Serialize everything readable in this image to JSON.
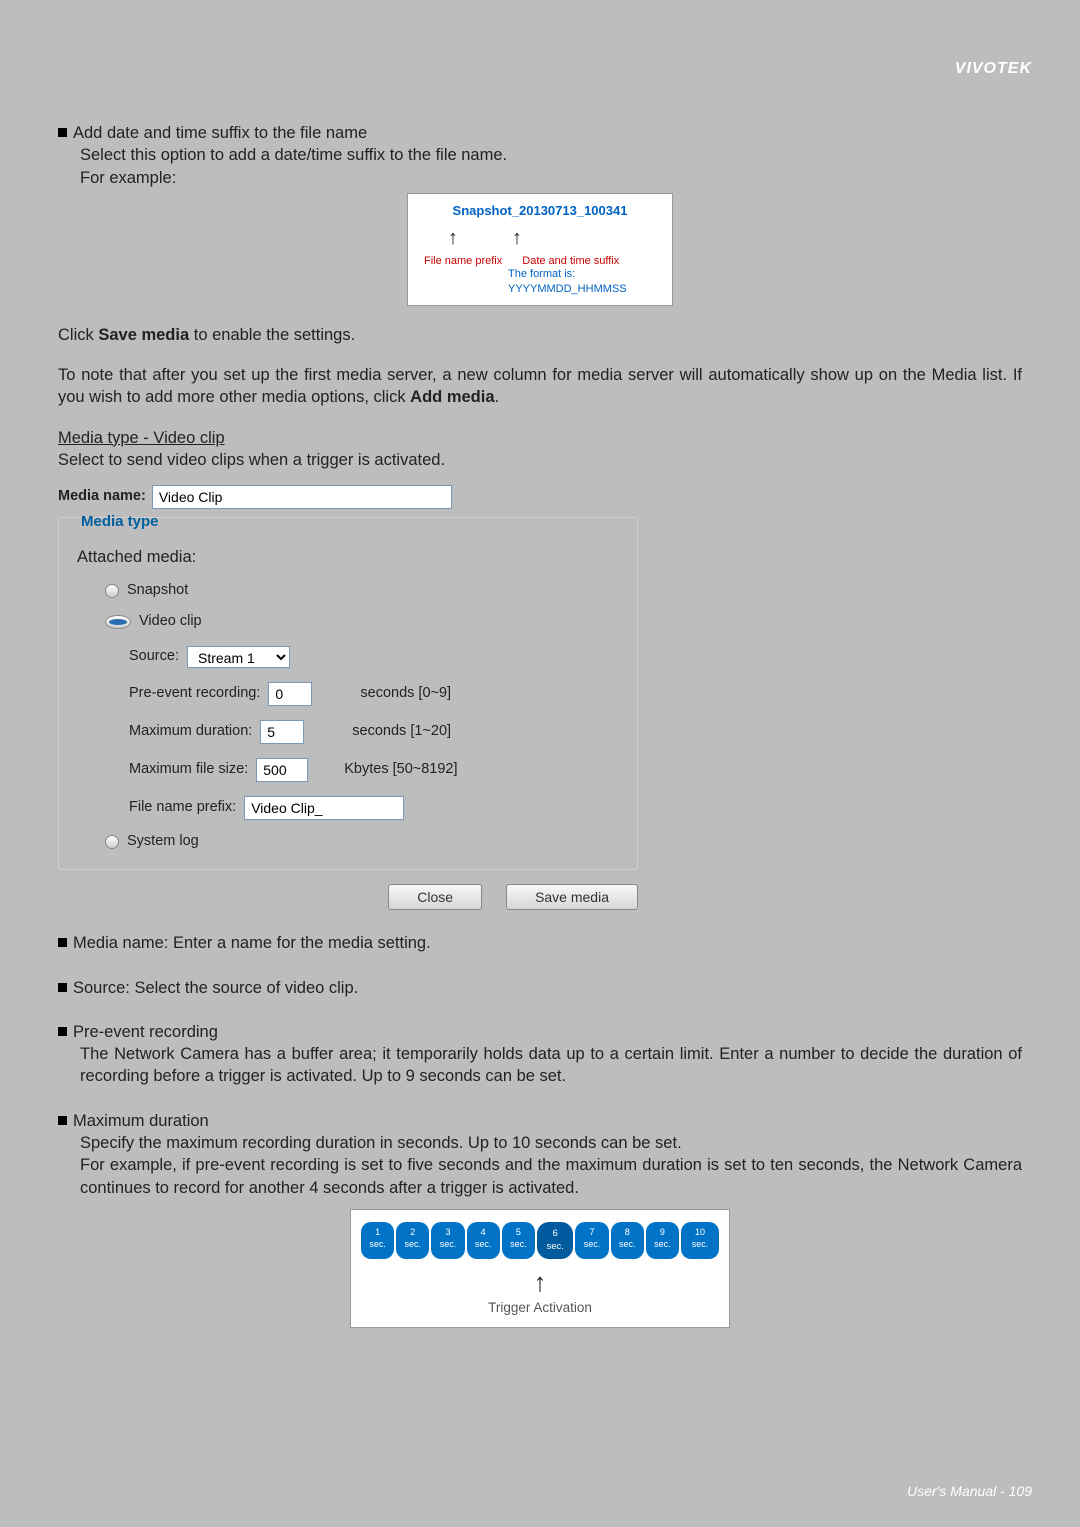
{
  "brand": "VIVOTEK",
  "bullet_add_suffix_title": "Add date and time suffix to the file name",
  "bullet_add_suffix_line1": "Select this option to add a date/time suffix to the file name.",
  "bullet_add_suffix_line2": "For example:",
  "snapshot": {
    "title": "Snapshot_20130713_100341",
    "fnp": "File name prefix",
    "dts": "Date and time suffix",
    "fmt": "The format is: YYYYMMDD_HHMMSS"
  },
  "click_save_pre": "Click ",
  "click_save_bold": "Save media",
  "click_save_post": " to enable the settings.",
  "note_para_pre": "To note that after you set up the first media server, a new column for media server will automatically show up on the Media list.  If you wish to add more other media options, click ",
  "note_para_bold": "Add media",
  "note_para_post": ".",
  "media_type_heading": "Media type - Video clip",
  "media_type_sub": "Select to send video clips when a trigger is activated.",
  "form": {
    "media_name_label": "Media name:",
    "media_name_value": "Video Clip",
    "legend": "Media type",
    "attached_media": "Attached media:",
    "snapshot": "Snapshot",
    "video_clip": "Video clip",
    "source_label": "Source:",
    "source_value": "Stream 1",
    "pre_event_label": "Pre-event recording:",
    "pre_event_value": "0",
    "pre_event_hint": "seconds [0~9]",
    "max_dur_label": "Maximum duration:",
    "max_dur_value": "5",
    "max_dur_hint": "seconds [1~20]",
    "max_size_label": "Maximum file size:",
    "max_size_value": "500",
    "max_size_hint": "Kbytes [50~8192]",
    "prefix_label": "File name prefix:",
    "prefix_value": "Video Clip_",
    "system_log": "System log",
    "close_btn": "Close",
    "save_btn": "Save media"
  },
  "bul_media_name": "Media name: Enter a name for the media setting.",
  "bul_source": "Source: Select the source of video clip.",
  "bul_preevent_title": "Pre-event recording",
  "bul_preevent_body": "The Network Camera has a buffer area; it temporarily holds data up to a certain limit. Enter a number to decide the duration of recording before a trigger is activated. Up to 9 seconds can be set.",
  "bul_maxdur_title": "Maximum duration",
  "bul_maxdur_l1": "Specify the maximum recording duration in seconds. Up to 10 seconds can be set.",
  "bul_maxdur_l2": "For example, if pre-event recording is set to five seconds and the maximum duration is set to ten seconds, the Network Camera continues to record for another 4 seconds after a trigger is activated.",
  "timeline": {
    "items": [
      "1 sec.",
      "2 sec.",
      "3 sec.",
      "4 sec.",
      "5 sec.",
      "6 sec.",
      "7 sec.",
      "8 sec.",
      "9 sec.",
      "10 sec."
    ],
    "label": "Trigger Activation"
  },
  "footer": "User's Manual - 109"
}
